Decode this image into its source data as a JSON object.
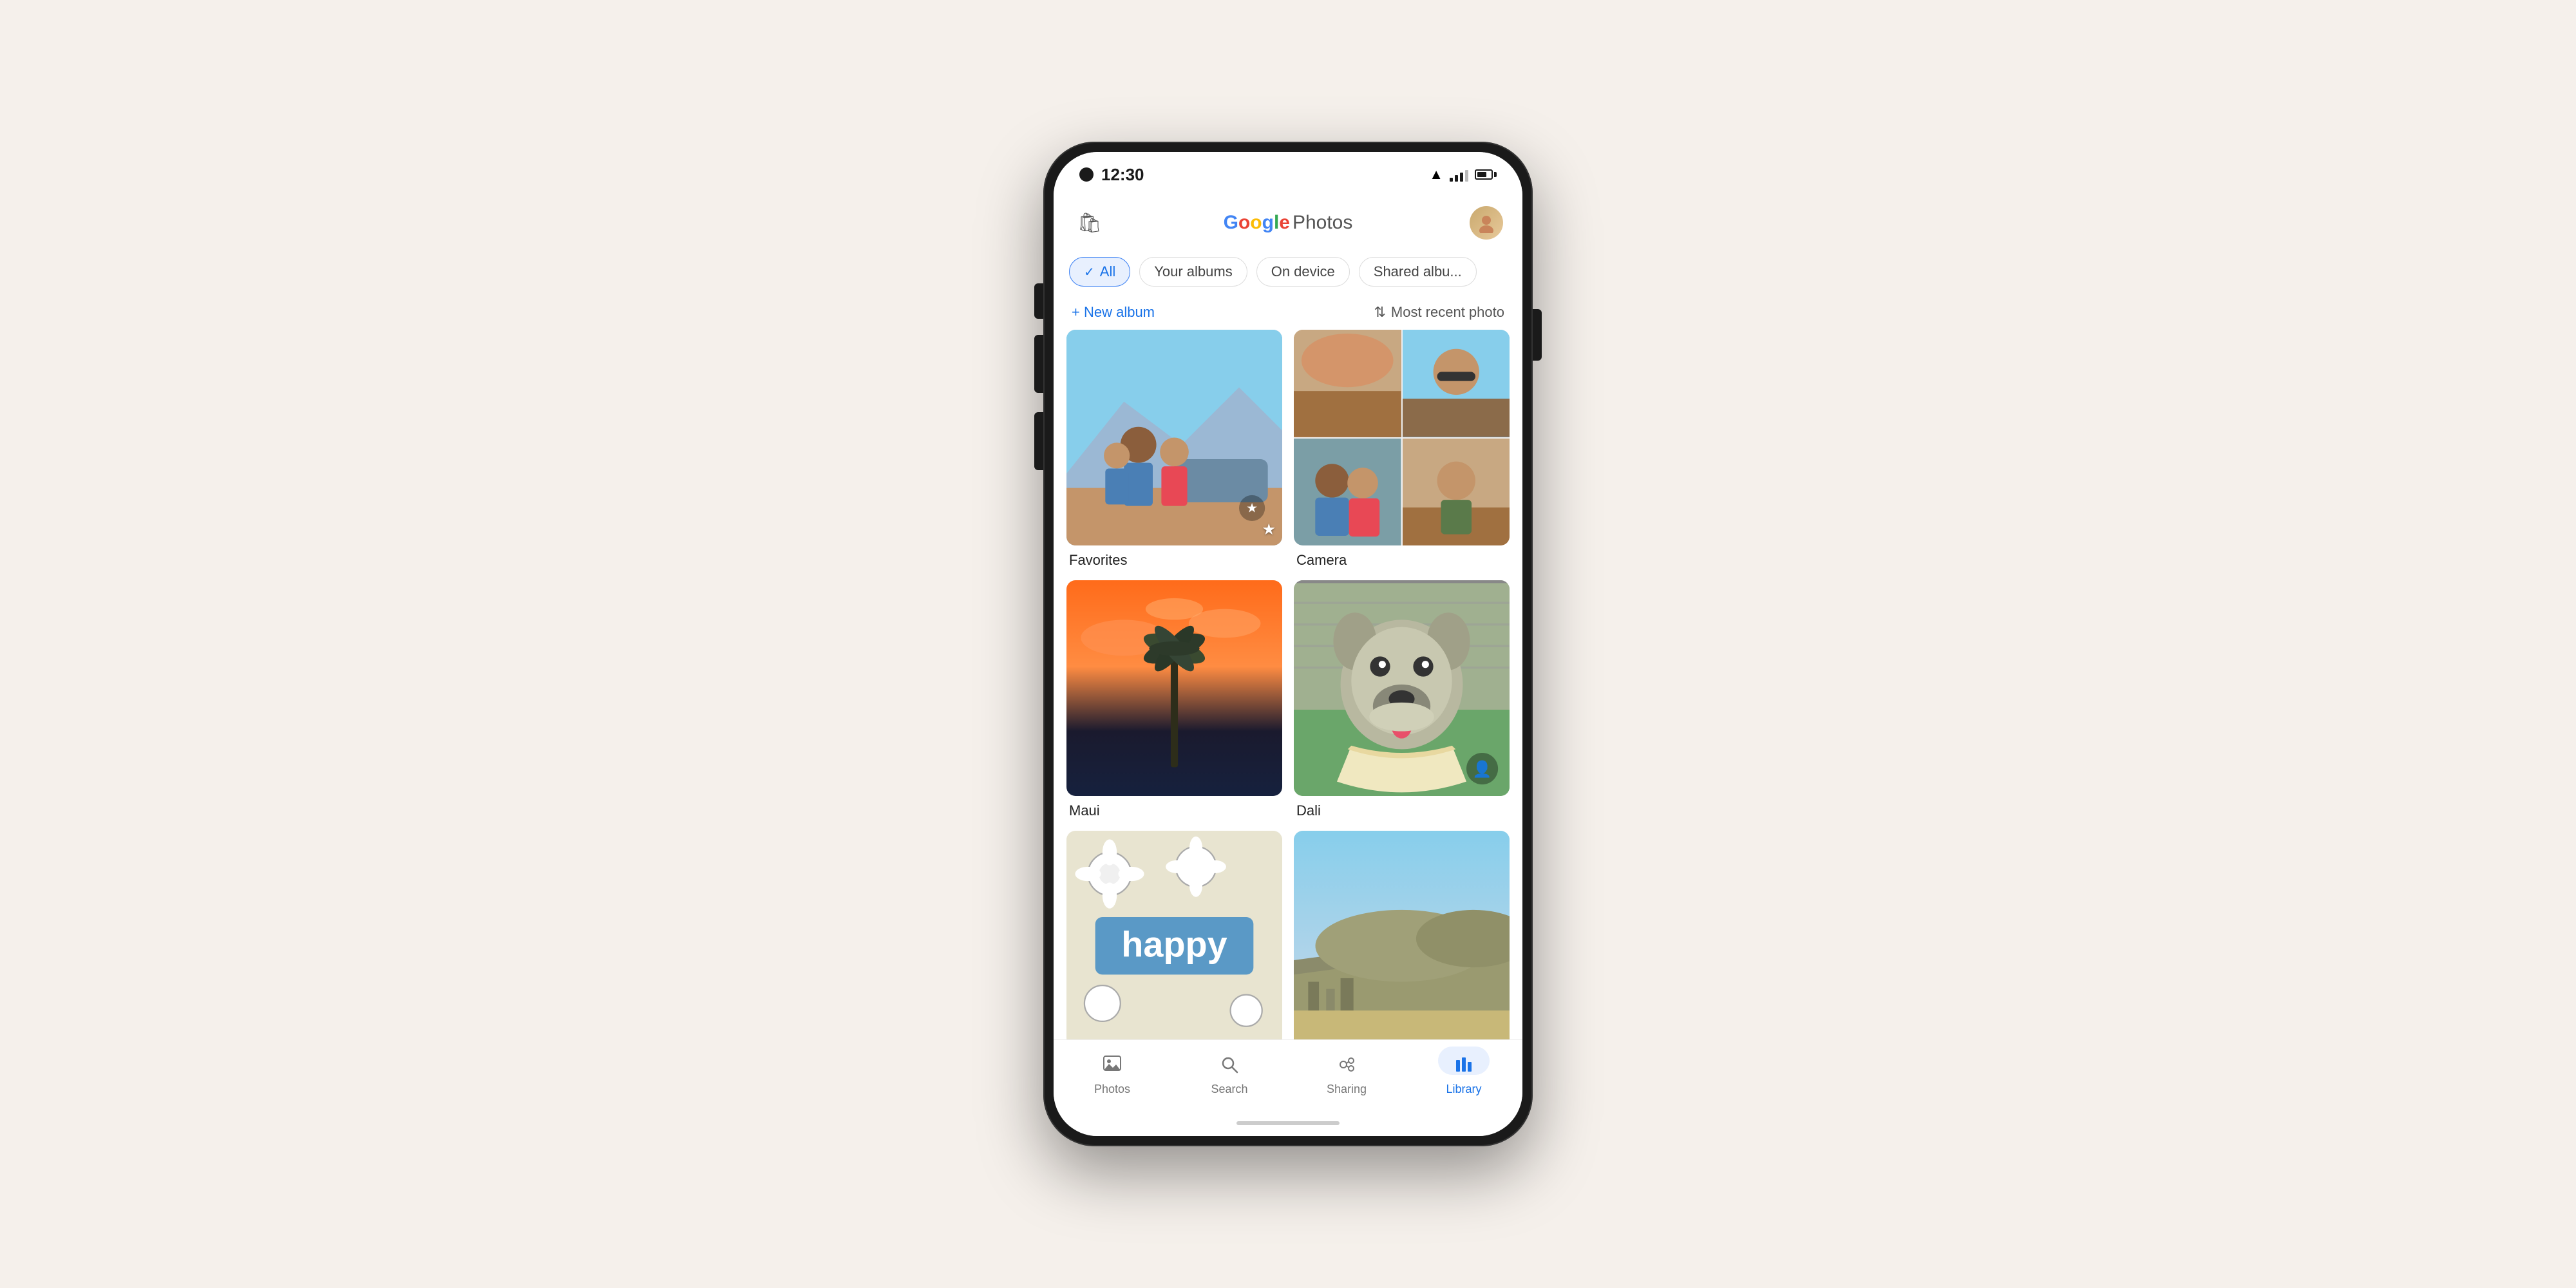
{
  "app": {
    "title": "Google Photos",
    "logo_google": "Google",
    "logo_photos": " Photos"
  },
  "status_bar": {
    "time": "12:30"
  },
  "header": {
    "shop_icon": "🛍",
    "avatar_initial": "👤"
  },
  "filters": [
    {
      "id": "all",
      "label": "All",
      "active": true
    },
    {
      "id": "your-albums",
      "label": "Your albums",
      "active": false
    },
    {
      "id": "on-device",
      "label": "On device",
      "active": false
    },
    {
      "id": "shared-albums",
      "label": "Shared albu...",
      "active": false
    }
  ],
  "actions": {
    "new_album": "+ New album",
    "sort": "Most recent photo"
  },
  "albums": [
    {
      "id": "favorites",
      "name": "Favorites",
      "type": "favorites"
    },
    {
      "id": "camera",
      "name": "Camera",
      "type": "camera"
    },
    {
      "id": "maui",
      "name": "Maui",
      "type": "maui"
    },
    {
      "id": "dali",
      "name": "Dali",
      "type": "dali"
    },
    {
      "id": "happy",
      "name": "",
      "type": "happy"
    },
    {
      "id": "landscape",
      "name": "",
      "type": "landscape"
    }
  ],
  "bottom_nav": [
    {
      "id": "photos",
      "label": "Photos",
      "icon": "🖼",
      "active": false
    },
    {
      "id": "search",
      "label": "Search",
      "icon": "🔍",
      "active": false
    },
    {
      "id": "sharing",
      "label": "Sharing",
      "icon": "👥",
      "active": false
    },
    {
      "id": "library",
      "label": "Library",
      "icon": "📊",
      "active": true
    }
  ]
}
